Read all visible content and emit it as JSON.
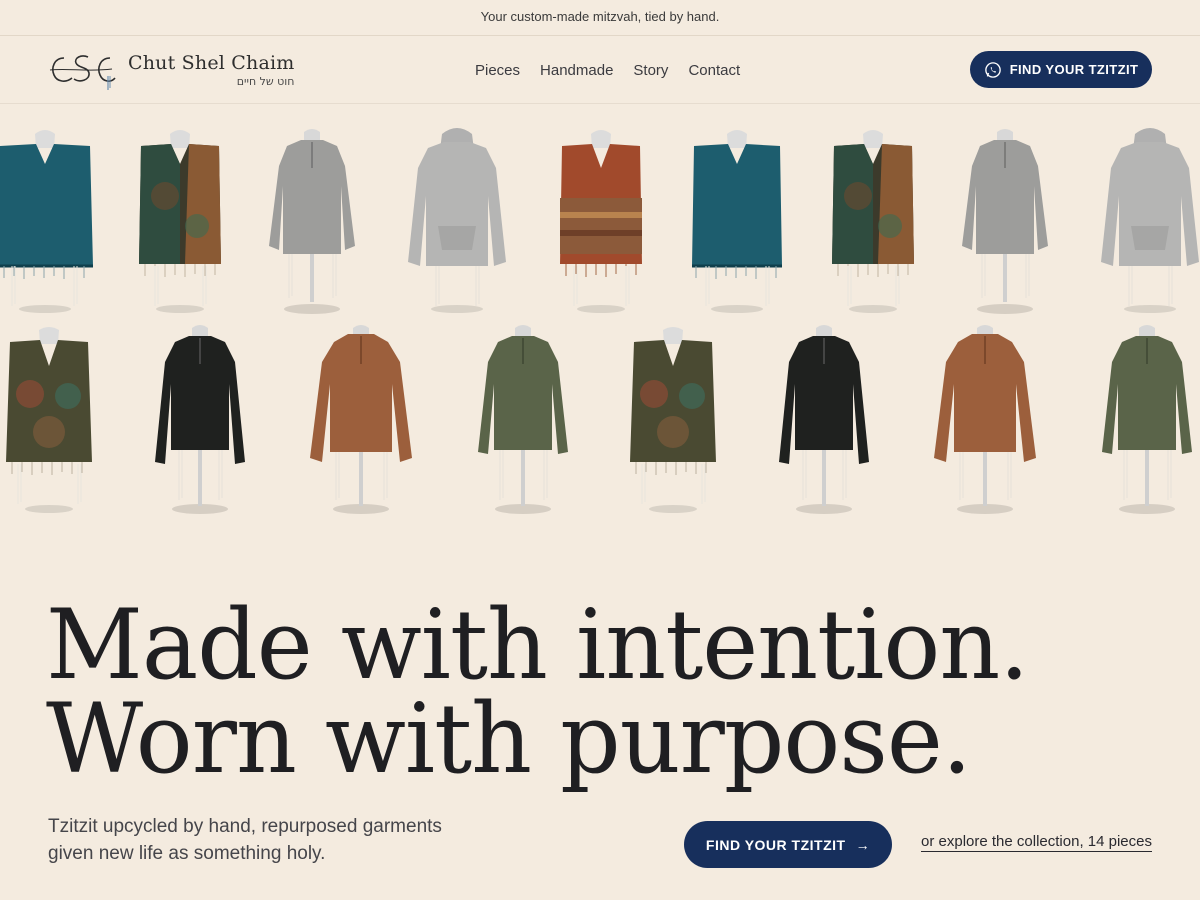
{
  "announcement": "Your custom-made mitzvah, tied by hand.",
  "brand": {
    "name": "Chut Shel Chaim",
    "hebrew": "חוט של חיים",
    "logo_icon": "csc-monogram-icon"
  },
  "nav": {
    "items": [
      "Pieces",
      "Handmade",
      "Story",
      "Contact"
    ]
  },
  "header_cta": {
    "label": "FIND YOUR TZITZIT",
    "icon": "whatsapp-icon"
  },
  "gallery": {
    "row1": [
      "teal-poncho",
      "paisley-poncho",
      "grey-quarter-zip",
      "grey-hoodie",
      "rust-paisley-poncho",
      "teal-poncho",
      "paisley-poncho",
      "grey-quarter-zip",
      "grey-hoodie"
    ],
    "row2": [
      "paisley-vest",
      "black-quarter-zip",
      "brown-quarter-zip",
      "olive-quarter-zip",
      "paisley-vest",
      "black-quarter-zip",
      "brown-quarter-zip",
      "olive-quarter-zip"
    ]
  },
  "hero": {
    "line1": "Made with intention.",
    "line2": "Worn with purpose.",
    "subtitle": "Tzitzit upcycled by hand, repurposed garments given new life as something holy.",
    "cta_label": "FIND YOUR TZITZIT",
    "cta_arrow": "→",
    "explore_label": "or explore the collection, 14 pieces"
  },
  "colors": {
    "background": "#f4ebdf",
    "accent": "#172f5c",
    "text": "#1f1f22"
  }
}
